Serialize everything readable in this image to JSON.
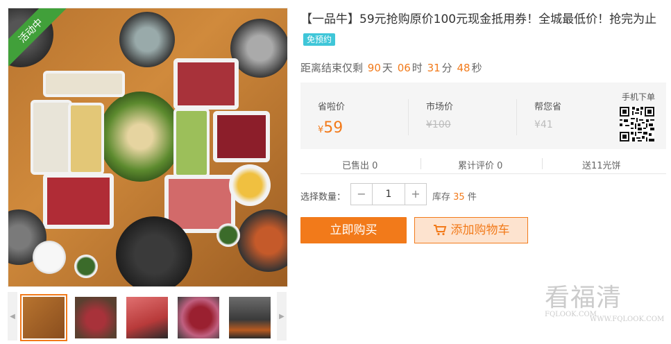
{
  "ribbon": "活动中",
  "title": "【一品牛】59元抢购原价100元现金抵用券！全城最低价！抢完为止",
  "badge": "免预约",
  "countdown": {
    "prefix": "距离结束仅剩",
    "days": "90",
    "days_unit": "天",
    "hours": "06",
    "hours_unit": "时",
    "minutes": "31",
    "minutes_unit": "分",
    "seconds": "48",
    "seconds_unit": "秒"
  },
  "prices": {
    "sale_label": "省啦价",
    "sale_currency": "¥",
    "sale_value": "59",
    "market_label": "市场价",
    "market_value": "¥100",
    "save_label": "帮您省",
    "save_value": "¥41",
    "mobile_label": "手机下单"
  },
  "stats": {
    "sold": "已售出 0",
    "reviews": "累计评价 0",
    "points": "送11光饼"
  },
  "quantity": {
    "label": "选择数量：",
    "minus": "−",
    "value": "1",
    "plus": "+",
    "stock_prefix": "库存",
    "stock_value": "35",
    "stock_unit": "件"
  },
  "buttons": {
    "buy": "立即购买",
    "cart": "添加购物车"
  },
  "watermark": {
    "text": "看福清",
    "url": "FQLOOK.COM",
    "url2": "WWW.FQLOOK.COM"
  },
  "colors": {
    "accent": "#f27a1a",
    "badge": "#3fc6d8",
    "ribbon": "#41a03a"
  }
}
